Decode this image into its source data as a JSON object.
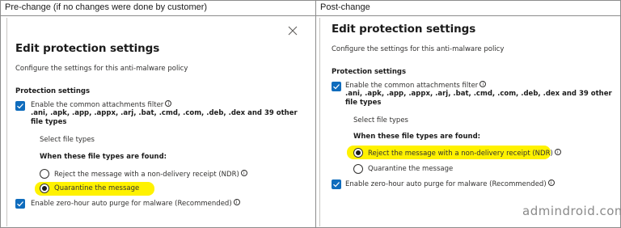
{
  "columns": {
    "pre_change": "Pre-change (if no changes were done by customer)",
    "post_change": "Post-change"
  },
  "dialog": {
    "title": "Edit protection settings",
    "subtitle": "Configure the settings for this anti-malware policy",
    "section_title": "Protection settings",
    "attachments_filter_label": "Enable the common attachments filter",
    "file_types_list": ".ani, .apk, .app, .appx, .arj, .bat, .cmd, .com, .deb, .dex and 39 other file types",
    "select_file_types_link": "Select file types",
    "when_found_label": "When these file types are found:",
    "option_reject": "Reject the message with a non-delivery receipt (NDR)",
    "option_quarantine": "Quarantine the message",
    "zero_hour_purge_label": "Enable zero-hour auto purge for malware (Recommended)"
  },
  "state": {
    "pre_change_selected": "Quarantine the message",
    "post_change_selected": "Reject the message with a non-delivery receipt (NDR)",
    "attachments_filter_checked": true,
    "zero_hour_purge_checked": true
  },
  "icons": {
    "info": "i",
    "close": "close-icon",
    "check": "check-icon"
  },
  "colors": {
    "checkbox": "#0f6cbd",
    "highlight": "#fff200",
    "watermark": "#8a8a8a"
  },
  "watermark": "admindroid.com"
}
